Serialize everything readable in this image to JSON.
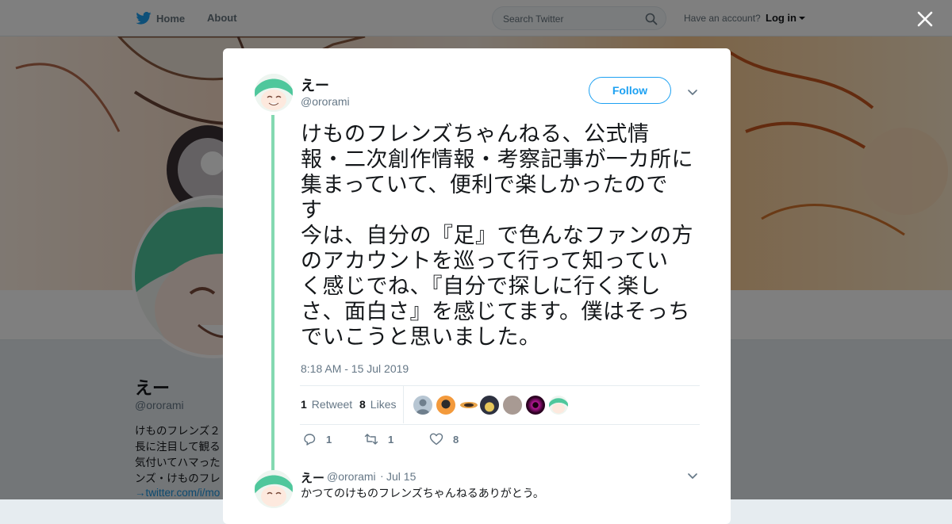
{
  "topbar": {
    "home_label": "Home",
    "about_label": "About",
    "search_placeholder": "Search Twitter",
    "account_prompt": "Have an account?",
    "login_label": "Log in"
  },
  "profile": {
    "name": "えー",
    "handle": "@ororami",
    "bio": "けものフレンズ２\n長に注目して観る\n気付いてハマった\nンズ・けものフレ",
    "bio_link": "→twitter.com/i/mo"
  },
  "modal": {
    "tweet": {
      "author_name": "えー",
      "author_handle": "@ororami",
      "follow_label": "Follow",
      "text": "けものフレンズちゃんねる、公式情\n報・二次創作情報・考察記事が一カ所に\n集まっていて、便利で楽しかったので\nす\n今は、自分の『足』で色んなファンの方\nのアカウントを巡って行って知ってい\nく感じでね、『自分で探しに行く楽し\nさ、面白さ』を感じてます。僕はそっち\nでいこうと思いました。",
      "timestamp": "8:18 AM - 15 Jul 2019",
      "retweet_count": "1",
      "retweet_label": "Retweet",
      "likes_count": "8",
      "likes_label": "Likes",
      "reply_action_count": "1",
      "retweet_action_count": "1",
      "like_action_count": "8"
    },
    "reply": {
      "author_name": "えー",
      "author_handle": "@ororami",
      "separator": "·",
      "date": "Jul 15",
      "text": "かつてのけものフレンズちゃんねるありがとう。"
    }
  },
  "colors": {
    "accent": "#1da1f2",
    "thread_line": "#84d9b1",
    "secondary_text": "#657786"
  }
}
